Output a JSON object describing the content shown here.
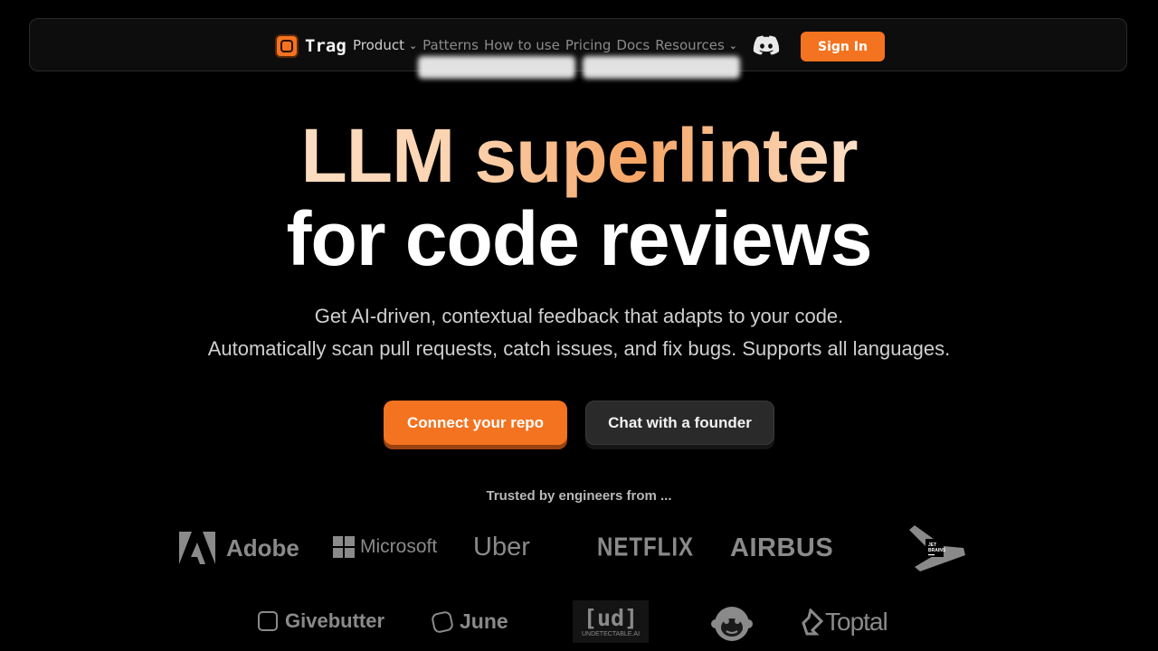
{
  "nav": {
    "brand": "Trag",
    "menu": [
      {
        "label": "Product",
        "dropdown": true,
        "obscured": false
      },
      {
        "label": "Patterns",
        "dropdown": false,
        "obscured": true
      },
      {
        "label": "How to use",
        "dropdown": false,
        "obscured": true
      },
      {
        "label": "Pricing",
        "dropdown": false,
        "obscured": true
      },
      {
        "label": "Docs",
        "dropdown": false,
        "obscured": true
      },
      {
        "label": "Resources",
        "dropdown": true,
        "obscured": true
      }
    ],
    "discord_icon": "discord-icon",
    "signin": "Sign In"
  },
  "hero": {
    "title_line1": "LLM superlinter",
    "title_line2": "for code reviews",
    "sub_line1": "Get AI-driven, contextual feedback that adapts to your code.",
    "sub_line2": "Automatically scan pull requests, catch issues, and fix bugs. Supports all languages.",
    "cta_primary": "Connect your repo",
    "cta_secondary": "Chat with a founder"
  },
  "trusted": {
    "label": "Trusted by engineers from ...",
    "logos_row1": [
      "Adobe",
      "Microsoft",
      "Uber",
      "NETFLIX",
      "AIRBUS",
      "JetBrains"
    ],
    "logos_row2": [
      "Givebutter",
      "June",
      "[ud]",
      "monkey-logo",
      "Toptal"
    ],
    "ud_caption": "UNDETECTABLE.AI"
  },
  "colors": {
    "accent": "#f47320",
    "background": "#000000",
    "logo_gray": "#8a8a8a"
  }
}
